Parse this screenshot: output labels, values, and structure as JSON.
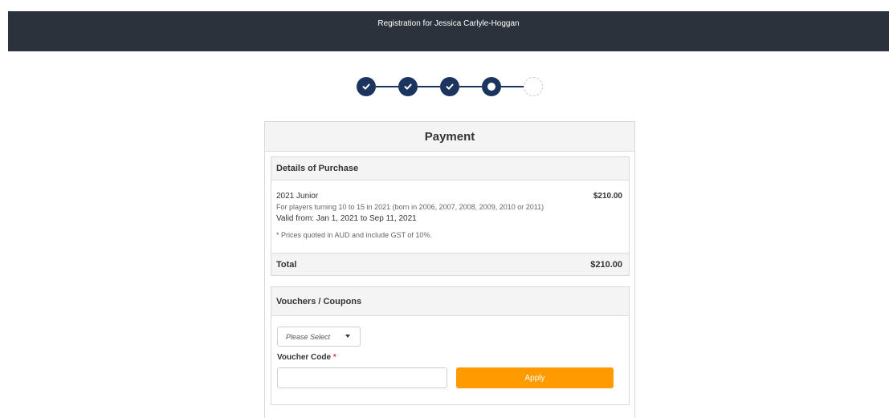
{
  "header": {
    "title": "Registration for Jessica Carlyle-Hoggan"
  },
  "stepper": {
    "total_steps": 5,
    "completed_steps": 3,
    "current_step": 4
  },
  "payment": {
    "title": "Payment",
    "details": {
      "heading": "Details of Purchase",
      "item_name": "2021 Junior",
      "item_price": "$210.00",
      "item_description": "For players turning 10 to 15 in 2021 (born in 2006, 2007, 2008, 2009, 2010 or 2011)",
      "valid_text": "Valid from: Jan 1, 2021 to Sep 11, 2021",
      "price_note": "* Prices quoted in AUD and include GST of 10%.",
      "total_label": "Total",
      "total_value": "$210.00"
    },
    "vouchers": {
      "heading": "Vouchers / Coupons",
      "select_value": "Please Select",
      "code_label": "Voucher Code",
      "required_mark": "*",
      "code_value": "",
      "apply_label": "Apply"
    }
  },
  "colors": {
    "topbar": "#2b323c",
    "step": "#1c355e",
    "apply": "#ff9a00"
  }
}
